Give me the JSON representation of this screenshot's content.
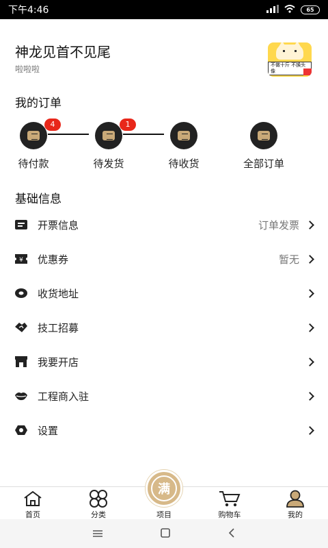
{
  "status_bar": {
    "time": "下午4:46",
    "signal": "4G",
    "battery": "65"
  },
  "profile": {
    "name": "神龙见首不见尾",
    "subtitle": "啦啦啦",
    "avatar_tag": "不做十斤 不换头像"
  },
  "orders": {
    "title": "我的订单",
    "items": [
      {
        "label": "待付款",
        "badge": "4"
      },
      {
        "label": "待发货",
        "badge": "1"
      },
      {
        "label": "待收货",
        "badge": ""
      },
      {
        "label": "全部订单",
        "badge": ""
      }
    ]
  },
  "basic_info": {
    "title": "基础信息",
    "items": [
      {
        "label": "开票信息",
        "value": "订单发票",
        "icon": "invoice-icon"
      },
      {
        "label": "优惠券",
        "value": "暂无",
        "icon": "coupon-icon"
      },
      {
        "label": "收货地址",
        "value": "",
        "icon": "location-icon"
      },
      {
        "label": "技工招募",
        "value": "",
        "icon": "handshake-icon"
      },
      {
        "label": "我要开店",
        "value": "",
        "icon": "store-icon"
      },
      {
        "label": "工程商入驻",
        "value": "",
        "icon": "lips-icon"
      },
      {
        "label": "设置",
        "value": "",
        "icon": "settings-icon"
      }
    ]
  },
  "bottom_nav": {
    "items": [
      {
        "label": "首页",
        "icon": "home-icon"
      },
      {
        "label": "分类",
        "icon": "category-icon"
      },
      {
        "label": "项目",
        "icon": "project-icon"
      },
      {
        "label": "购物车",
        "icon": "cart-icon"
      },
      {
        "label": "我的",
        "icon": "profile-icon"
      }
    ],
    "center_glyph": "满"
  },
  "colors": {
    "accent": "#d7b989",
    "badge": "#e8271a",
    "icon_dark": "#222222"
  }
}
